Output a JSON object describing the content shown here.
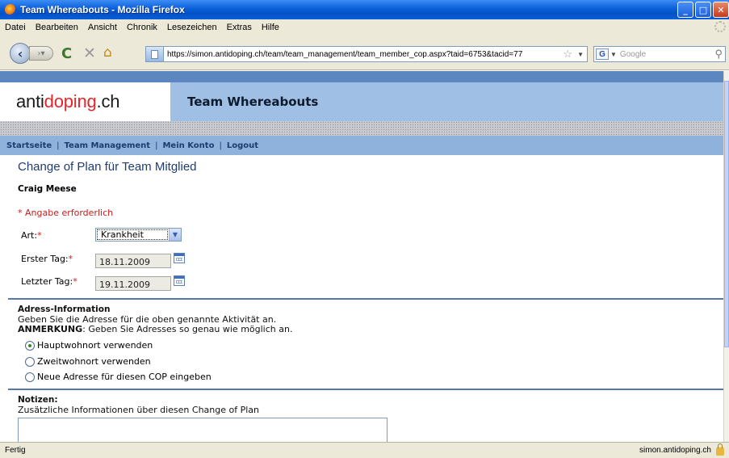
{
  "window": {
    "title": "Team Whereabouts - Mozilla Firefox"
  },
  "menu": [
    "Datei",
    "Bearbeiten",
    "Ansicht",
    "Chronik",
    "Lesezeichen",
    "Extras",
    "Hilfe"
  ],
  "toolbar": {
    "url": "https://simon.antidoping.ch/team/team_management/team_member_cop.aspx?taid=6753&tacid=77",
    "search_placeholder": "Google",
    "search_engine_icon": "G"
  },
  "site": {
    "logo_part1": "anti",
    "logo_part2": "doping",
    "logo_part3": ".ch",
    "logo_accent_color": "#e5252a",
    "header_title": "Team Whereabouts",
    "nav": [
      "Startseite",
      "Team Management",
      "Mein Konto",
      "Logout"
    ]
  },
  "page": {
    "title": "Change of Plan für Team Mitglied",
    "member_name": "Craig Meese",
    "required_note": "* Angabe erforderlich",
    "required_marker": "*"
  },
  "form": {
    "art_label": "Art:",
    "art_value": "Krankheit",
    "erster_tag_label": "Erster Tag:",
    "erster_tag_value": "18.11.2009",
    "letzter_tag_label": "Letzter Tag:",
    "letzter_tag_value": "19.11.2009"
  },
  "address": {
    "heading": "Adress-Information",
    "line1": "Geben Sie die Adresse für die oben genannte Aktivität an.",
    "note_label": "ANMERKUNG",
    "note_text": ": Geben Sie Adresses so genau wie möglich an.",
    "options": [
      {
        "label": "Hauptwohnort verwenden",
        "checked": true
      },
      {
        "label": "Zweitwohnort verwenden",
        "checked": false
      },
      {
        "label": "Neue Adresse für diesen COP eingeben",
        "checked": false
      }
    ]
  },
  "notes": {
    "heading": "Notizen:",
    "description": "Zusätzliche Informationen über diesen Change of Plan",
    "value": ""
  },
  "status": {
    "left": "Fertig",
    "domain": "simon.antidoping.ch"
  }
}
